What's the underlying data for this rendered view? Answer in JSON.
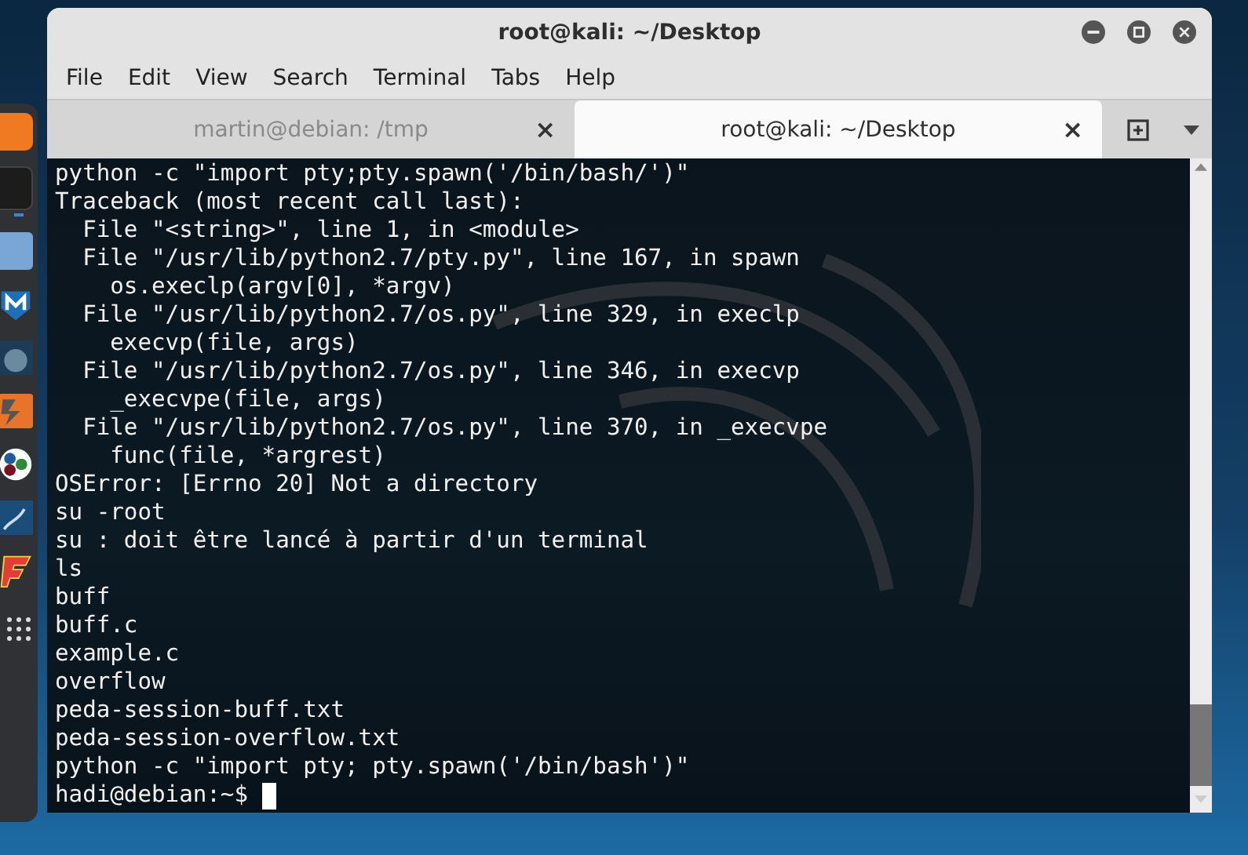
{
  "window": {
    "title": "root@kali: ~/Desktop"
  },
  "menu": [
    "File",
    "Edit",
    "View",
    "Search",
    "Terminal",
    "Tabs",
    "Help"
  ],
  "tabs": [
    {
      "label": "martin@debian: /tmp",
      "selected": false,
      "close": "×"
    },
    {
      "label": "root@kali: ~/Desktop",
      "selected": true,
      "close": "×"
    }
  ],
  "terminal": {
    "lines": [
      "python -c \"import pty;pty.spawn('/bin/bash/')\"",
      "Traceback (most recent call last):",
      "  File \"<string>\", line 1, in <module>",
      "  File \"/usr/lib/python2.7/pty.py\", line 167, in spawn",
      "    os.execlp(argv[0], *argv)",
      "  File \"/usr/lib/python2.7/os.py\", line 329, in execlp",
      "    execvp(file, args)",
      "  File \"/usr/lib/python2.7/os.py\", line 346, in execvp",
      "    _execvpe(file, args)",
      "  File \"/usr/lib/python2.7/os.py\", line 370, in _execvpe",
      "    func(file, *argrest)",
      "OSError: [Errno 20] Not a directory",
      "su -root",
      "su : doit être lancé à partir d'un terminal",
      "ls",
      "buff",
      "buff.c",
      "example.c",
      "overflow",
      "peda-session-buff.txt",
      "peda-session-overflow.txt",
      "python -c \"import pty; pty.spawn('/bin/bash')\""
    ],
    "prompt": "hadi@debian:~$ "
  }
}
